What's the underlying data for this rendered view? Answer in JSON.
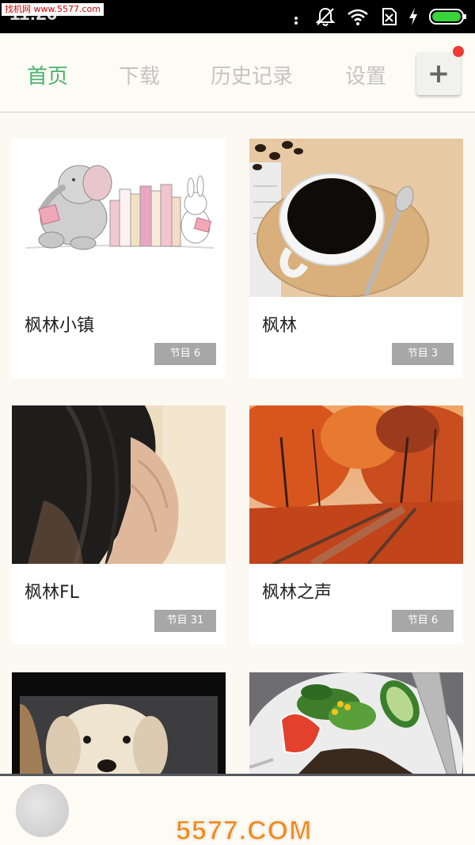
{
  "status_bar": {
    "time": "11:26",
    "watermark": "找机网 www.5577.com",
    "icons": [
      "more-dots-icon",
      "mute-icon",
      "wifi-icon",
      "no-sim-icon",
      "charging-icon",
      "battery-icon"
    ]
  },
  "tabs": [
    {
      "label": "首页",
      "active": true
    },
    {
      "label": "下载",
      "active": false
    },
    {
      "label": "历史记录",
      "active": false
    },
    {
      "label": "设置",
      "active": false
    }
  ],
  "add_button": {
    "label": "+",
    "has_notification": true
  },
  "cards": [
    {
      "title": "枫林小镇",
      "badge": "节目 6",
      "image": "elephant-bunny-books"
    },
    {
      "title": "枫林",
      "badge": "节目 3",
      "image": "coffee-cup"
    },
    {
      "title": "枫林FL",
      "badge": "节目 31",
      "image": "woman-hair"
    },
    {
      "title": "枫林之声",
      "badge": "节目 6",
      "image": "autumn-railway"
    },
    {
      "title": "",
      "badge": "",
      "image": "puppy"
    },
    {
      "title": "",
      "badge": "",
      "image": "steak-salad"
    }
  ],
  "watermark_bottom": "5577.COM",
  "colors": {
    "active_tab": "#49b36c",
    "inactive_tab": "#c4c4c4",
    "badge_bg": "#a7a7a7",
    "notify_dot": "#f03a33",
    "page_bg": "#fbf9f1"
  }
}
